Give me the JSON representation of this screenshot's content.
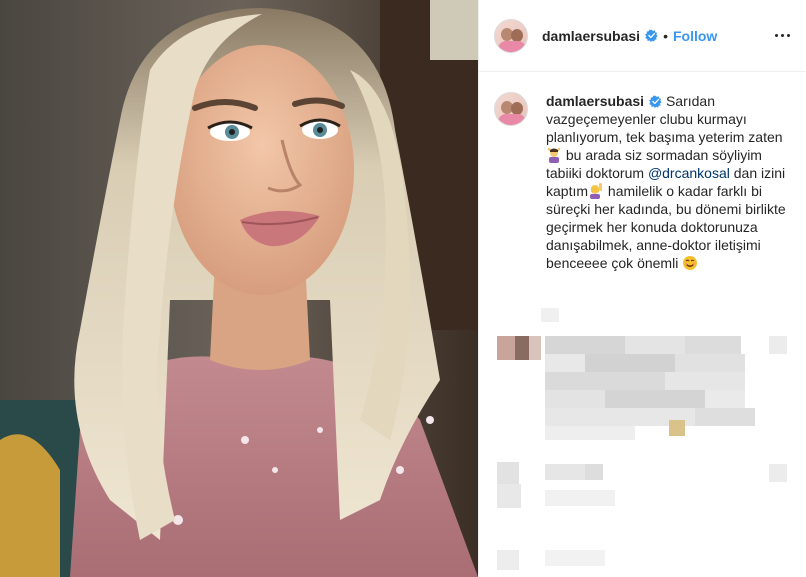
{
  "post": {
    "username": "damlaersubasi",
    "follow_label": "Follow",
    "separator": "•",
    "caption": {
      "username": "damlaersubasi",
      "part1": "Sarıdan vazgeçemeyenler clubu kurmayı planlıyorum, tek başıma yeterim zaten ",
      "part2": " bu arada siz sormadan söyliyim tabiiki doktorum ",
      "mention": "@drcankosal",
      "part3": " dan izini kaptım",
      "part4": " hamilelik o kadar farklı bi süreçki her kadında, bu dönemi birlikte geçirmek her konuda doktorunuza danışabilmek, anne-doktor iletişimi benceeee çok önemli "
    },
    "icons": {
      "verified": "verified-badge-icon",
      "more": "more-options-icon",
      "emoji1": "woman-gesturing-ok-emoji",
      "emoji2": "woman-raising-hand-emoji",
      "emoji3": "smiling-face-emoji"
    }
  },
  "colors": {
    "follow": "#3897f0",
    "verified": "#3897f0",
    "mention": "#003569",
    "text": "#262626",
    "divider": "#efefef"
  }
}
